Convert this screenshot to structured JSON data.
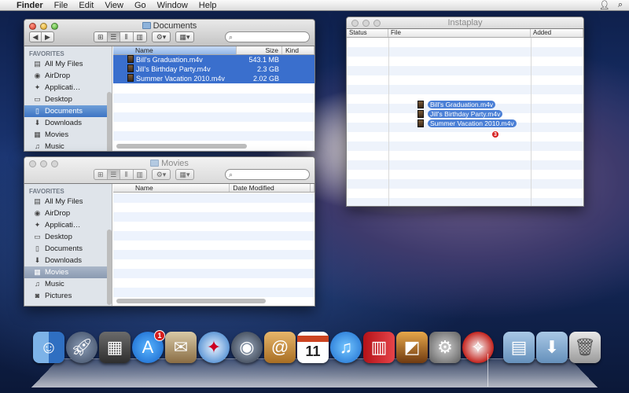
{
  "menubar": {
    "app": "Finder",
    "items": [
      "File",
      "Edit",
      "View",
      "Go",
      "Window",
      "Help"
    ]
  },
  "documents_window": {
    "title": "Documents",
    "search_placeholder": "",
    "sidebar_header": "FAVORITES",
    "sidebar": [
      {
        "label": "All My Files",
        "icon": "all-files-icon",
        "glyph": "▤"
      },
      {
        "label": "AirDrop",
        "icon": "airdrop-icon",
        "glyph": "◉"
      },
      {
        "label": "Applicati…",
        "icon": "applications-icon",
        "glyph": "✦"
      },
      {
        "label": "Desktop",
        "icon": "desktop-icon",
        "glyph": "▭"
      },
      {
        "label": "Documents",
        "icon": "documents-icon",
        "glyph": "▯",
        "selected": true
      },
      {
        "label": "Downloads",
        "icon": "downloads-icon",
        "glyph": "⬇"
      },
      {
        "label": "Movies",
        "icon": "movies-icon",
        "glyph": "▦"
      },
      {
        "label": "Music",
        "icon": "music-icon",
        "glyph": "♫"
      }
    ],
    "columns": {
      "name": "Name",
      "size": "Size",
      "kind": "Kind"
    },
    "files": [
      {
        "name": "Bill's Graduation.m4v",
        "size": "543.1 MB",
        "kind": ""
      },
      {
        "name": "Jill's Birthday Party.m4v",
        "size": "2.3 GB",
        "kind": ""
      },
      {
        "name": "Summer Vacation 2010.m4v",
        "size": "2.02 GB",
        "kind": ""
      }
    ]
  },
  "movies_window": {
    "title": "Movies",
    "search_placeholder": "",
    "sidebar_header": "FAVORITES",
    "sidebar": [
      {
        "label": "All My Files",
        "icon": "all-files-icon",
        "glyph": "▤"
      },
      {
        "label": "AirDrop",
        "icon": "airdrop-icon",
        "glyph": "◉"
      },
      {
        "label": "Applicati…",
        "icon": "applications-icon",
        "glyph": "✦"
      },
      {
        "label": "Desktop",
        "icon": "desktop-icon",
        "glyph": "▭"
      },
      {
        "label": "Documents",
        "icon": "documents-icon",
        "glyph": "▯"
      },
      {
        "label": "Downloads",
        "icon": "downloads-icon",
        "glyph": "⬇"
      },
      {
        "label": "Movies",
        "icon": "movies-icon",
        "glyph": "▦",
        "selected": true
      },
      {
        "label": "Music",
        "icon": "music-icon",
        "glyph": "♫"
      },
      {
        "label": "Pictures",
        "icon": "pictures-icon",
        "glyph": "◙"
      }
    ],
    "columns": {
      "name": "Name",
      "date_modified": "Date Modified"
    }
  },
  "instaplay_window": {
    "title": "Instaplay",
    "columns": {
      "status": "Status",
      "file": "File",
      "added": "Added"
    },
    "drag_items": [
      "Bill's Graduation.m4v",
      "Jill's Birthday Party.m4v",
      "Summer Vacation 2010.m4v"
    ],
    "drag_count": "3"
  },
  "dock": {
    "appstore_badge": "1",
    "calendar_day": "11"
  },
  "colors": {
    "selection": "#3a6fcd",
    "sidebar_bg": "#dfe4ea",
    "badge": "#d51d1d"
  }
}
